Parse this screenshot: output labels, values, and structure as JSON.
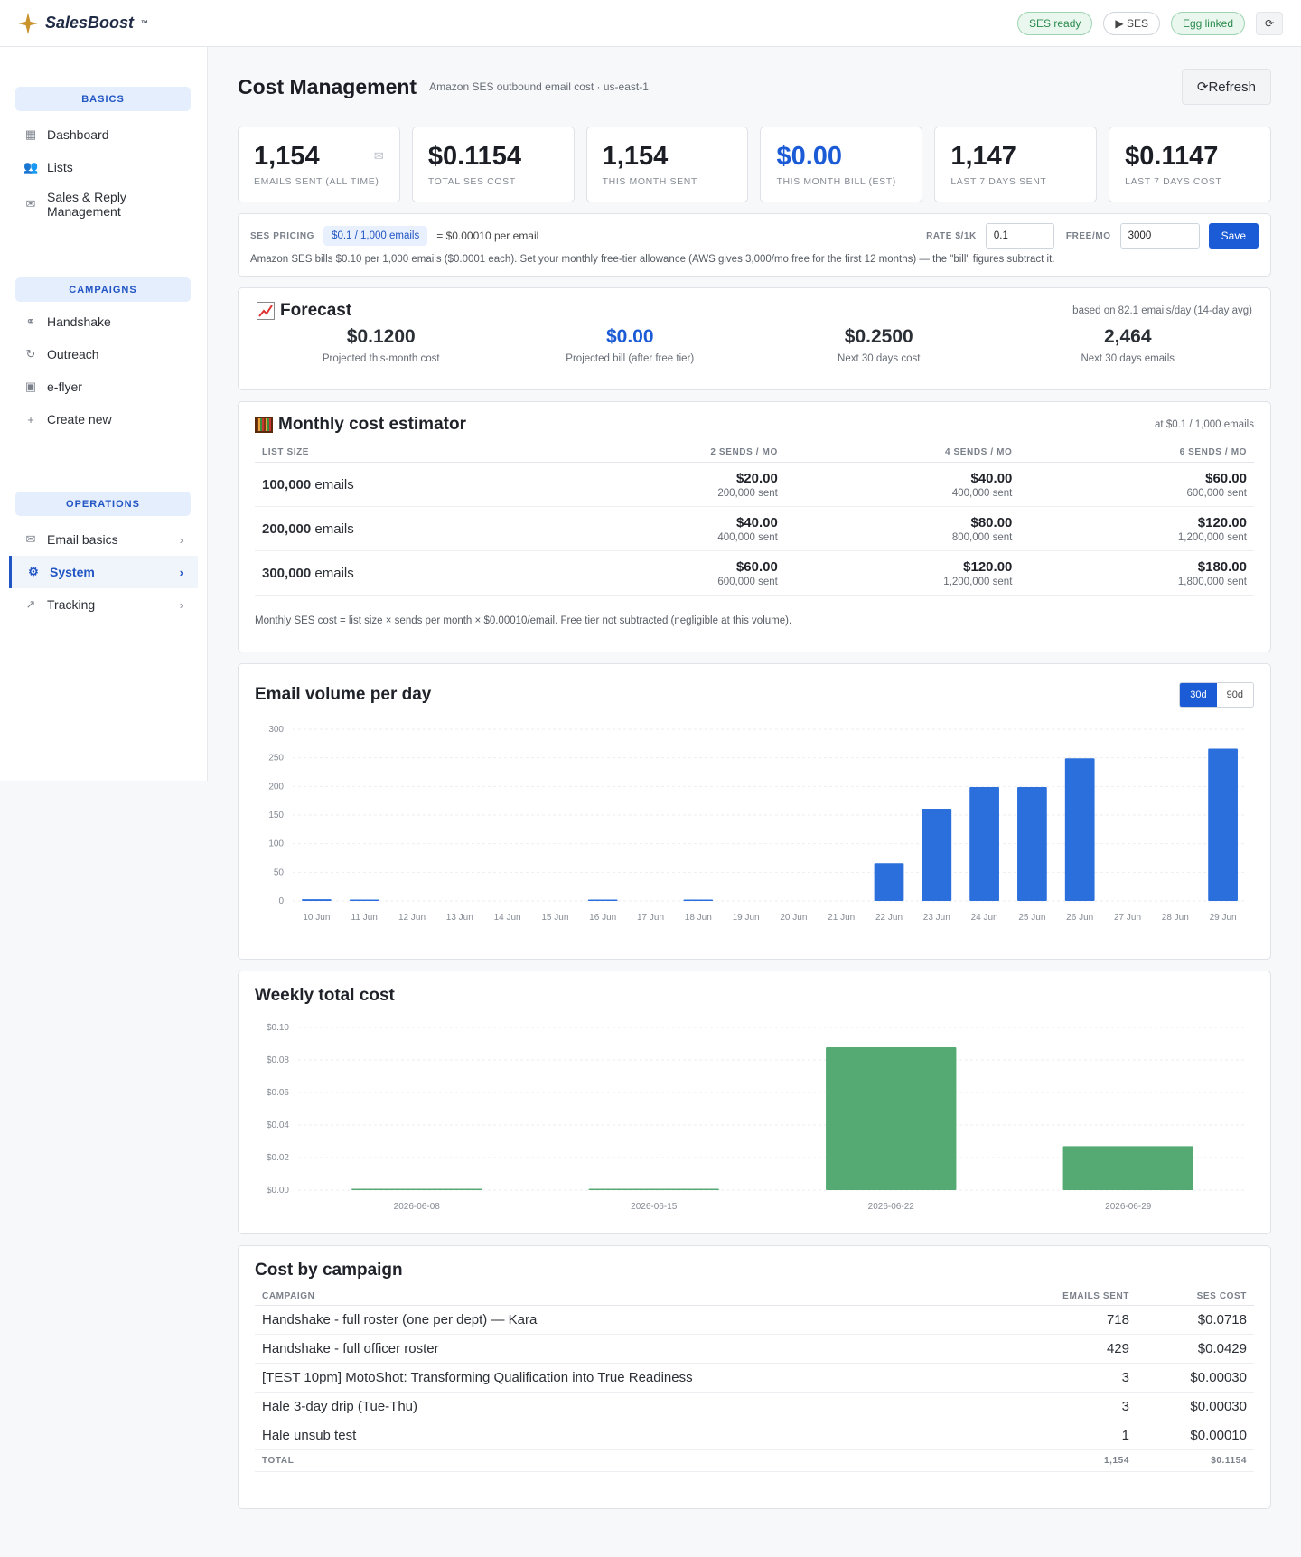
{
  "app": {
    "brand": "SalesBoost",
    "brand_mark": "™",
    "status_pills": [
      "SES ready",
      "▶ SES",
      "Egg linked"
    ],
    "reload_icon": "reload-icon"
  },
  "sidebar": {
    "sections": [
      {
        "title": "BASICS",
        "items": [
          {
            "label": "Dashboard",
            "icon": "dashboard-icon"
          },
          {
            "label": "Lists",
            "icon": "users-icon"
          },
          {
            "label": "Sales & Reply Management",
            "icon": "inbox-icon"
          }
        ]
      },
      {
        "title": "CAMPAIGNS",
        "items": [
          {
            "label": "Handshake",
            "icon": "handshake-icon"
          },
          {
            "label": "Outreach",
            "icon": "refresh-icon"
          },
          {
            "label": "e-flyer",
            "icon": "mailbox-icon"
          },
          {
            "label": "Create new",
            "icon": "plus-icon"
          }
        ]
      },
      {
        "title": "OPERATIONS",
        "items": [
          {
            "label": "Email basics",
            "icon": "envelope-icon"
          },
          {
            "label": "System",
            "icon": "gear-icon",
            "active": true
          },
          {
            "label": "Tracking",
            "icon": "trend-icon"
          }
        ]
      }
    ]
  },
  "page": {
    "title": "Cost Management",
    "subtitle": "Amazon SES outbound email cost · us-east-1",
    "refresh_label": "Refresh"
  },
  "stats": [
    {
      "value": "1,154",
      "label": "EMAILS SENT (ALL TIME)",
      "highlight": false
    },
    {
      "value": "$0.1154",
      "label": "TOTAL SES COST",
      "highlight": false
    },
    {
      "value": "1,154",
      "label": "THIS MONTH SENT",
      "highlight": false
    },
    {
      "value": "$0.00",
      "label": "THIS MONTH BILL (EST)",
      "highlight": true
    },
    {
      "value": "1,147",
      "label": "LAST 7 DAYS SENT",
      "highlight": false
    },
    {
      "value": "$0.1147",
      "label": "LAST 7 DAYS COST",
      "highlight": false
    }
  ],
  "pricing": {
    "label": "SES PRICING",
    "chip": "$0.1 / 1,000 emails",
    "per_email": "= $0.00010 per email",
    "rate_label": "RATE $/1K",
    "rate_value": "0.1",
    "free_label": "FREE/MO",
    "free_value": "3000",
    "save_label": "Save",
    "note": "Amazon SES bills $0.10 per 1,000 emails ($0.0001 each). Set your monthly free-tier allowance (AWS gives 3,000/mo free for the first 12 months) — the \"bill\" figures subtract it."
  },
  "forecast": {
    "title": "Forecast",
    "note": "based on 82.1 emails/day (14-day avg)",
    "items": [
      {
        "value": "$0.1200",
        "label": "Projected this-month cost",
        "highlight": false
      },
      {
        "value": "$0.00",
        "label": "Projected bill (after free tier)",
        "highlight": true
      },
      {
        "value": "$0.2500",
        "label": "Next 30 days cost",
        "highlight": false
      },
      {
        "value": "2,464",
        "label": "Next 30 days emails",
        "highlight": false
      }
    ]
  },
  "estimator": {
    "title": "Monthly cost estimator",
    "note": "at $0.1 / 1,000 emails",
    "headers": [
      "LIST SIZE",
      "2 SENDS / MO",
      "4 SENDS / MO",
      "6 SENDS / MO"
    ],
    "rows": [
      {
        "size": "100,000",
        "unit": "emails",
        "cells": [
          [
            "$20.00",
            "200,000 sent"
          ],
          [
            "$40.00",
            "400,000 sent"
          ],
          [
            "$60.00",
            "600,000 sent"
          ]
        ]
      },
      {
        "size": "200,000",
        "unit": "emails",
        "cells": [
          [
            "$40.00",
            "400,000 sent"
          ],
          [
            "$80.00",
            "800,000 sent"
          ],
          [
            "$120.00",
            "1,200,000 sent"
          ]
        ]
      },
      {
        "size": "300,000",
        "unit": "emails",
        "cells": [
          [
            "$60.00",
            "600,000 sent"
          ],
          [
            "$120.00",
            "1,200,000 sent"
          ],
          [
            "$180.00",
            "1,800,000 sent"
          ]
        ]
      }
    ],
    "footnote": "Monthly SES cost = list size × sends per month × $0.00010/email. Free tier not subtracted (negligible at this volume)."
  },
  "volume": {
    "title": "Email volume per day",
    "range_options": [
      "30d",
      "90d"
    ],
    "selected_range": "30d"
  },
  "weekly": {
    "title": "Weekly total cost"
  },
  "chart_data": [
    {
      "type": "bar",
      "title": "Email volume per day",
      "categories": [
        "10 Jun",
        "11 Jun",
        "12 Jun",
        "13 Jun",
        "14 Jun",
        "15 Jun",
        "16 Jun",
        "17 Jun",
        "18 Jun",
        "19 Jun",
        "20 Jun",
        "21 Jun",
        "22 Jun",
        "23 Jun",
        "24 Jun",
        "25 Jun",
        "26 Jun",
        "27 Jun",
        "28 Jun",
        "29 Jun"
      ],
      "values": [
        3,
        1,
        0,
        0,
        0,
        0,
        1,
        0,
        2,
        0,
        0,
        0,
        66,
        161,
        199,
        199,
        249,
        0,
        0,
        266
      ],
      "ylim": [
        0,
        300
      ],
      "yticks": [
        0,
        50,
        100,
        150,
        200,
        250,
        300
      ],
      "color": "#2a6fdb",
      "grid": true
    },
    {
      "type": "bar",
      "title": "Weekly total cost",
      "categories": [
        "2026-06-08",
        "2026-06-15",
        "2026-06-22",
        "2026-06-29"
      ],
      "values": [
        0.0003,
        0.0003,
        0.0878,
        0.027
      ],
      "ylim": [
        0,
        0.1
      ],
      "yticks": [
        "$0.00",
        "$0.02",
        "$0.04",
        "$0.06",
        "$0.08",
        "$0.10"
      ],
      "color": "#55aa73",
      "grid": true
    }
  ],
  "campaigns": {
    "title": "Cost by campaign",
    "headers": [
      "CAMPAIGN",
      "EMAILS SENT",
      "SES COST"
    ],
    "rows": [
      [
        "Handshake - full roster (one per dept) — Kara",
        "718",
        "$0.0718"
      ],
      [
        "Handshake - full officer roster",
        "429",
        "$0.0429"
      ],
      [
        "[TEST 10pm] MotoShot: Transforming Qualification into True Readiness",
        "3",
        "$0.00030"
      ],
      [
        "Hale 3-day drip (Tue-Thu)",
        "3",
        "$0.00030"
      ],
      [
        "Hale unsub test",
        "1",
        "$0.00010"
      ]
    ],
    "total": [
      "TOTAL",
      "1,154",
      "$0.1154"
    ]
  }
}
